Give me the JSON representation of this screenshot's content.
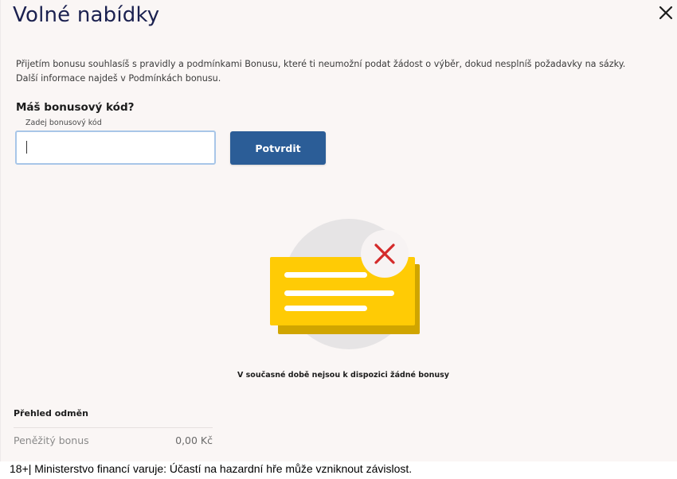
{
  "header": {
    "title": "Volné nabídky",
    "close_icon": "close-icon"
  },
  "info": {
    "line1": "Přijetím bonusu souhlasíš s pravidly a podmínkami Bonusu, které ti neumožní podat žádost o výběr, dokud nesplníš požadavky na sázky.",
    "line2": "Další informace najdeš v Podmínkách bonusu."
  },
  "bonus_code": {
    "question": "Máš bonusový kód?",
    "field_label": "Zadej bonusový kód",
    "value": "",
    "submit_label": "Potvrdit"
  },
  "empty_state": {
    "icon": "no-bonus-card-icon",
    "message": "V současné době nejsou k dispozici žádné bonusy"
  },
  "rewards": {
    "title": "Přehled odměn",
    "items": [
      {
        "label": "Peněžitý bonus",
        "value": "0,00 Kč"
      }
    ]
  },
  "footer": {
    "disclaimer": "18+| Ministerstvo financí varuje: Účastí na hazardní hře může vzniknout závislost."
  },
  "colors": {
    "title": "#1b2150",
    "button": "#2b5d97",
    "input_border": "#a8c6e8",
    "card_yellow": "#ffcb05",
    "card_shadow": "#d0a500",
    "x_red": "#d42a2a",
    "panel_bg": "#faf6f5"
  }
}
